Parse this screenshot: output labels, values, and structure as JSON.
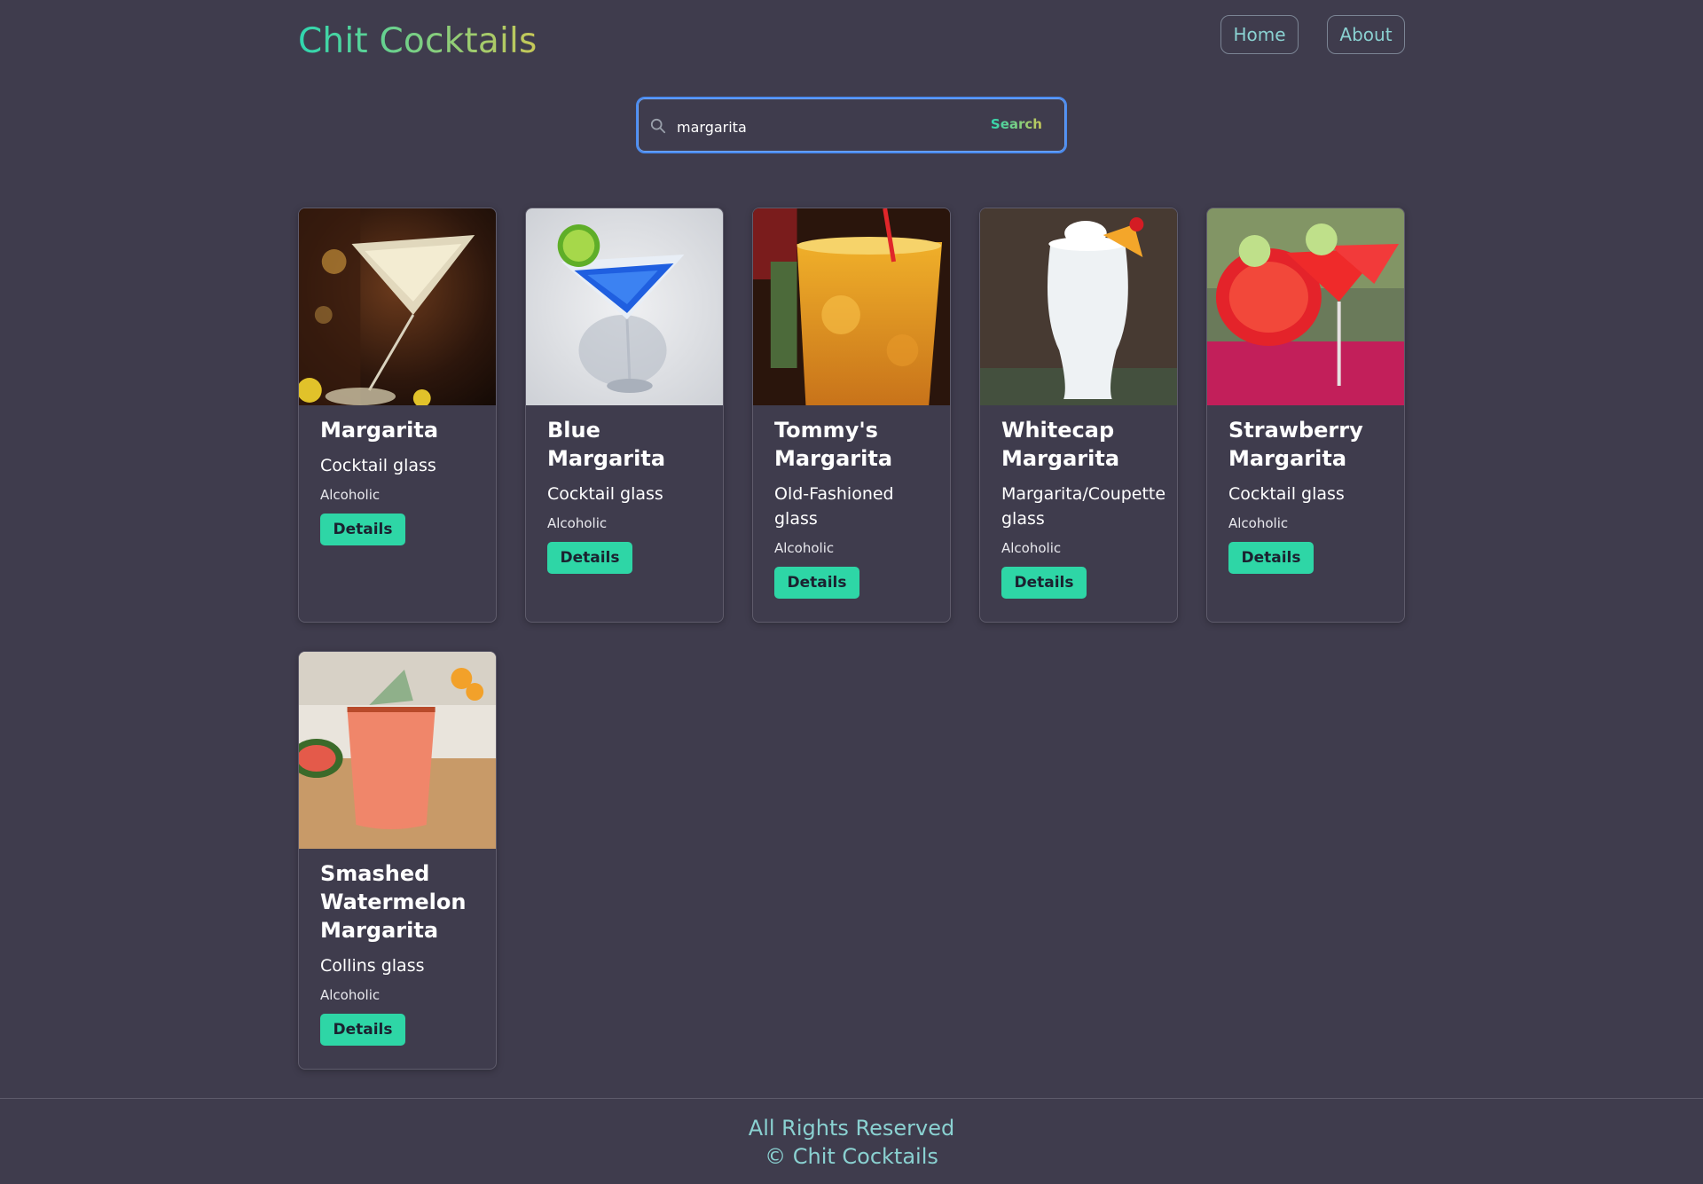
{
  "header": {
    "brand": "Chit Cocktails",
    "nav": {
      "home": "Home",
      "about": "About"
    }
  },
  "search": {
    "value": "margarita",
    "button_label": "Search"
  },
  "cards": [
    {
      "title": "Margarita",
      "glass": "Cocktail glass",
      "type": "Alcoholic",
      "button": "Details"
    },
    {
      "title": "Blue Margarita",
      "glass": "Cocktail glass",
      "type": "Alcoholic",
      "button": "Details"
    },
    {
      "title": "Tommy's Margarita",
      "glass": "Old-Fashioned glass",
      "type": "Alcoholic",
      "button": "Details"
    },
    {
      "title": "Whitecap Margarita",
      "glass": "Margarita/Coupette glass",
      "type": "Alcoholic",
      "button": "Details"
    },
    {
      "title": "Strawberry Margarita",
      "glass": "Cocktail glass",
      "type": "Alcoholic",
      "button": "Details"
    },
    {
      "title": "Smashed Watermelon Margarita",
      "glass": "Collins glass",
      "type": "Alcoholic",
      "button": "Details"
    }
  ],
  "footer": {
    "line1": "All Rights Reserved",
    "line2": "© Chit Cocktails"
  },
  "colors": {
    "background": "#3f3c4d",
    "accent_green": "#2ed6a6",
    "link_teal": "#8ad1d1",
    "search_border": "#4a8cf2"
  }
}
